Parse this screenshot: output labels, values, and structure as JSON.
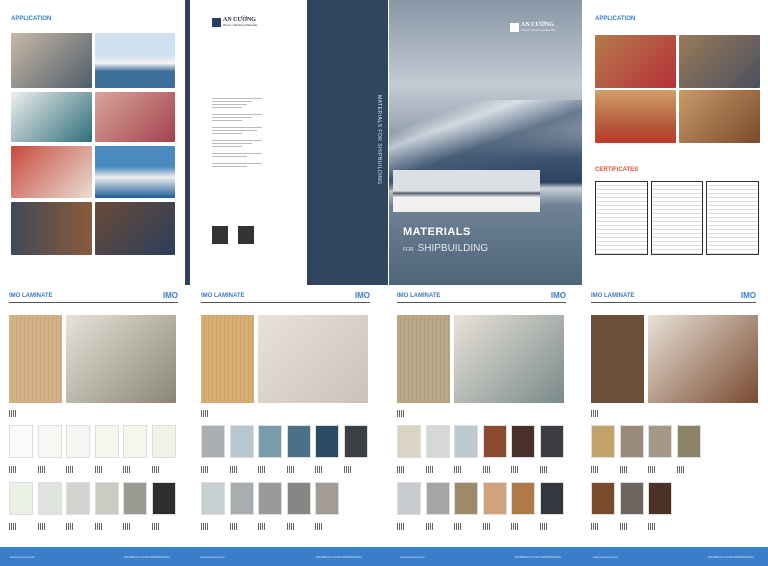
{
  "left_page": {
    "title": "APPLICATION"
  },
  "back_cover": {
    "brand": "AN CƯỜNG",
    "tagline": "Wood • Working Materials"
  },
  "spine": {
    "text": "MATERIALS FOR SHIPBUILDING"
  },
  "cover": {
    "brand": "AN CƯỜNG",
    "tagline": "Wood • Working Materials",
    "title": "MATERIALS",
    "subtitle_prefix": "FOR",
    "subtitle": "SHIPBUILDING"
  },
  "right_page": {
    "title": "APPLICATION",
    "certificates_title": "CERTIFICATES"
  },
  "bottom_pages": [
    {
      "title": "IMO LAMINATE",
      "badge": "IMO",
      "main": "#d4b286",
      "photo": "#8a8578",
      "row1": [
        "#fbfbfb",
        "#f8f8f5",
        "#f6f6f2",
        "#f8f7ee",
        "#f8f7ec",
        "#f3f2e6"
      ],
      "row2": [
        "#e9f0e4",
        "#dfe3dd",
        "#d3d4cf",
        "#cacbc3",
        "#9a9b92",
        "#2c2d2f"
      ]
    },
    {
      "title": "IMO LAMINATE",
      "badge": "IMO",
      "main": "#d8ae74",
      "photo": "#c9c2b8",
      "row1": [
        "#a9aeb2",
        "#b7c7cf",
        "#7a9bab",
        "#4b7189",
        "#2c4b66",
        "#3a3e45"
      ],
      "row2": [
        "#c9d0d3",
        "#a8adb0",
        "#9a9a98",
        "#868684",
        "#a29c94"
      ]
    },
    {
      "title": "IMO LAMINATE",
      "badge": "IMO",
      "main": "#bba889",
      "photo": "#7a8a8a",
      "row1": [
        "#d9d4c4",
        "#d6d8d6",
        "#bdcbd1",
        "#8a4a30",
        "#4a3028",
        "#3c3d40"
      ],
      "row2": [
        "#c8ccd0",
        "#a4a6a6",
        "#9c8a68",
        "#d0a37c",
        "#b07a48",
        "#34383e"
      ]
    },
    {
      "title": "IMO LAMINATE",
      "badge": "IMO",
      "main": "#6e5038",
      "photo": "#7a4a30",
      "row1": [
        "#c4a26c",
        "#9a8a7a",
        "#a49888",
        "#8c8468"
      ],
      "row2": [
        "#7a4a2c",
        "#6e6560",
        "#4a3226"
      ]
    }
  ],
  "footer": {
    "url": "www.ancuong.com",
    "label": "MATERIALS FOR SHIPBUILDING"
  }
}
